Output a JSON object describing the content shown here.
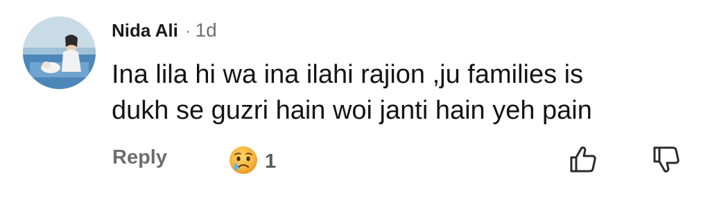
{
  "comment": {
    "author": "Nida Ali",
    "separator": "·",
    "time": "1d",
    "text_line1": "Ina lila hi wa ina ilahi rajion ,ju families is",
    "text_line2": "dukh se guzri hain woi janti hain yeh pain"
  },
  "actions": {
    "reply_label": "Reply",
    "reaction_icon": "crying-face-icon",
    "reaction_count": "1",
    "like_icon": "thumbs-up-icon",
    "dislike_icon": "thumbs-down-icon"
  },
  "colors": {
    "author": "#1a1a1a",
    "meta": "#707070",
    "body": "#141414",
    "reply": "#6d6d6d",
    "icon_stroke": "#2a2a2a"
  }
}
